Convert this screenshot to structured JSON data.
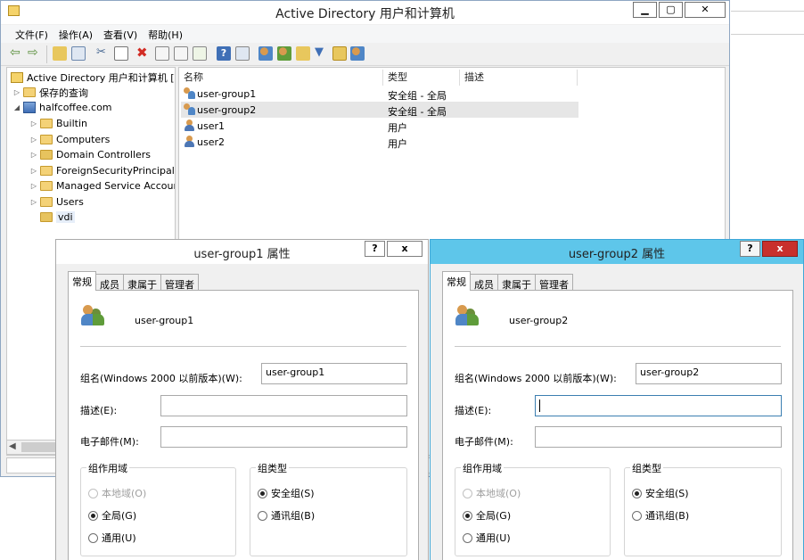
{
  "mmc": {
    "title": "Active Directory 用户和计算机",
    "menus": [
      "文件(F)",
      "操作(A)",
      "查看(V)",
      "帮助(H)"
    ],
    "tree": {
      "root": "Active Directory 用户和计算机 [W",
      "saved_queries": "保存的查询",
      "domain": "halfcoffee.com",
      "children": [
        "Builtin",
        "Computers",
        "Domain Controllers",
        "ForeignSecurityPrincipals",
        "Managed Service Accoun",
        "Users",
        "vdi"
      ]
    },
    "list": {
      "columns": [
        "名称",
        "类型",
        "描述"
      ],
      "rows": [
        {
          "name": "user-group1",
          "type": "安全组 - 全局",
          "icon": "group-icon"
        },
        {
          "name": "user-group2",
          "type": "安全组 - 全局",
          "icon": "group-icon"
        },
        {
          "name": "user1",
          "type": "用户",
          "icon": "user-icon"
        },
        {
          "name": "user2",
          "type": "用户",
          "icon": "user-icon"
        }
      ]
    }
  },
  "dialog1": {
    "title": "user-group1 属性",
    "help": "?",
    "close": "x",
    "tabs": [
      "常规",
      "成员",
      "隶属于",
      "管理者"
    ],
    "group_name": "user-group1",
    "label_pre2000": "组名(Windows 2000 以前版本)(W):",
    "value_pre2000": "user-group1",
    "label_desc": "描述(E):",
    "value_desc": "",
    "label_email": "电子邮件(M):",
    "value_email": "",
    "scope_title": "组作用域",
    "scope_options": [
      "本地域(O)",
      "全局(G)",
      "通用(U)"
    ],
    "type_title": "组类型",
    "type_options": [
      "安全组(S)",
      "通讯组(B)"
    ]
  },
  "dialog2": {
    "title": "user-group2 属性",
    "help": "?",
    "close": "x",
    "tabs": [
      "常规",
      "成员",
      "隶属于",
      "管理者"
    ],
    "group_name": "user-group2",
    "label_pre2000": "组名(Windows 2000 以前版本)(W):",
    "value_pre2000": "user-group2",
    "label_desc": "描述(E):",
    "value_desc": "",
    "label_email": "电子邮件(M):",
    "value_email": "",
    "scope_title": "组作用域",
    "scope_options": [
      "本地域(O)",
      "全局(G)",
      "通用(U)"
    ],
    "type_title": "组类型",
    "type_options": [
      "安全组(S)",
      "通讯组(B)"
    ]
  },
  "colors": {
    "active_title": "#5ec6ea",
    "close_red": "#c8302c"
  }
}
